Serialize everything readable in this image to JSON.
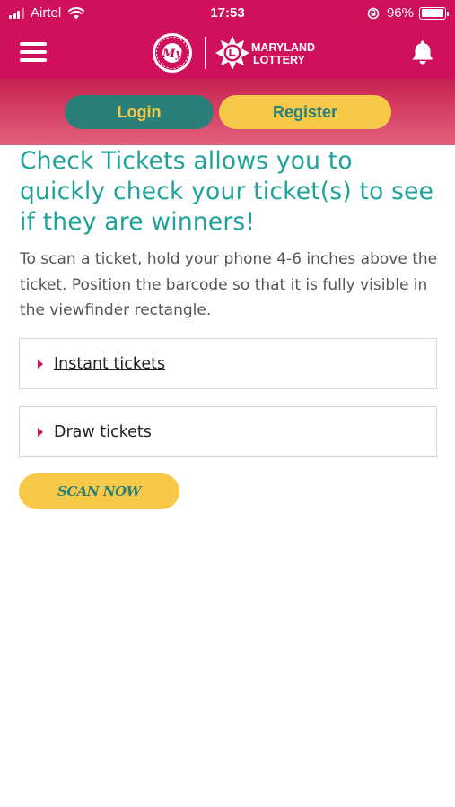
{
  "status_bar": {
    "carrier": "Airtel",
    "time": "17:53",
    "battery_percent": "96%",
    "battery_level": 0.96
  },
  "header": {
    "logo_rewards_text": "My",
    "logo_brand_line1": "MARYLAND",
    "logo_brand_line2": "LOTTERY"
  },
  "auth": {
    "login_label": "Login",
    "register_label": "Register"
  },
  "content": {
    "headline": "Check Tickets allows you to quickly check your ticket(s) to see if they are winners!",
    "intro": "To scan a ticket, hold your phone 4-6 inches above the ticket. Position the barcode so that it is fully visible in the viewfinder rectangle.",
    "sections": [
      {
        "label": "Instant tickets"
      },
      {
        "label": "Draw tickets"
      }
    ],
    "scan_button": "SCAN NOW"
  },
  "colors": {
    "brand_magenta": "#d0105c",
    "teal": "#2a8078",
    "headline_teal": "#1ea29a",
    "yellow": "#f7c948",
    "caret": "#c8134f"
  }
}
